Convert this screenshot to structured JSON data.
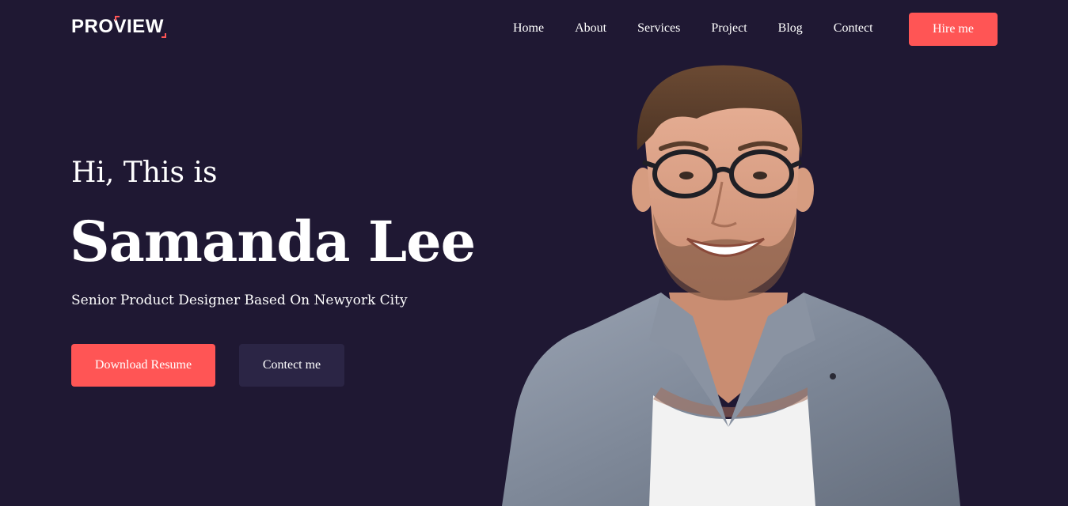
{
  "header": {
    "logo_text": "PROVIEW",
    "nav": [
      {
        "label": "Home"
      },
      {
        "label": "About"
      },
      {
        "label": "Services"
      },
      {
        "label": "Project"
      },
      {
        "label": "Blog"
      },
      {
        "label": "Contect"
      }
    ],
    "hire_label": "Hire me"
  },
  "hero": {
    "greeting": "Hi, This is",
    "name": "Samanda Lee",
    "tagline": "Senior Product Designer Based On Newyork City",
    "primary_cta": "Download Resume",
    "secondary_cta": "Contect me"
  },
  "colors": {
    "background": "#1f1833",
    "accent": "#ff5555",
    "secondary_button": "#2b2545",
    "text": "#ffffff"
  }
}
